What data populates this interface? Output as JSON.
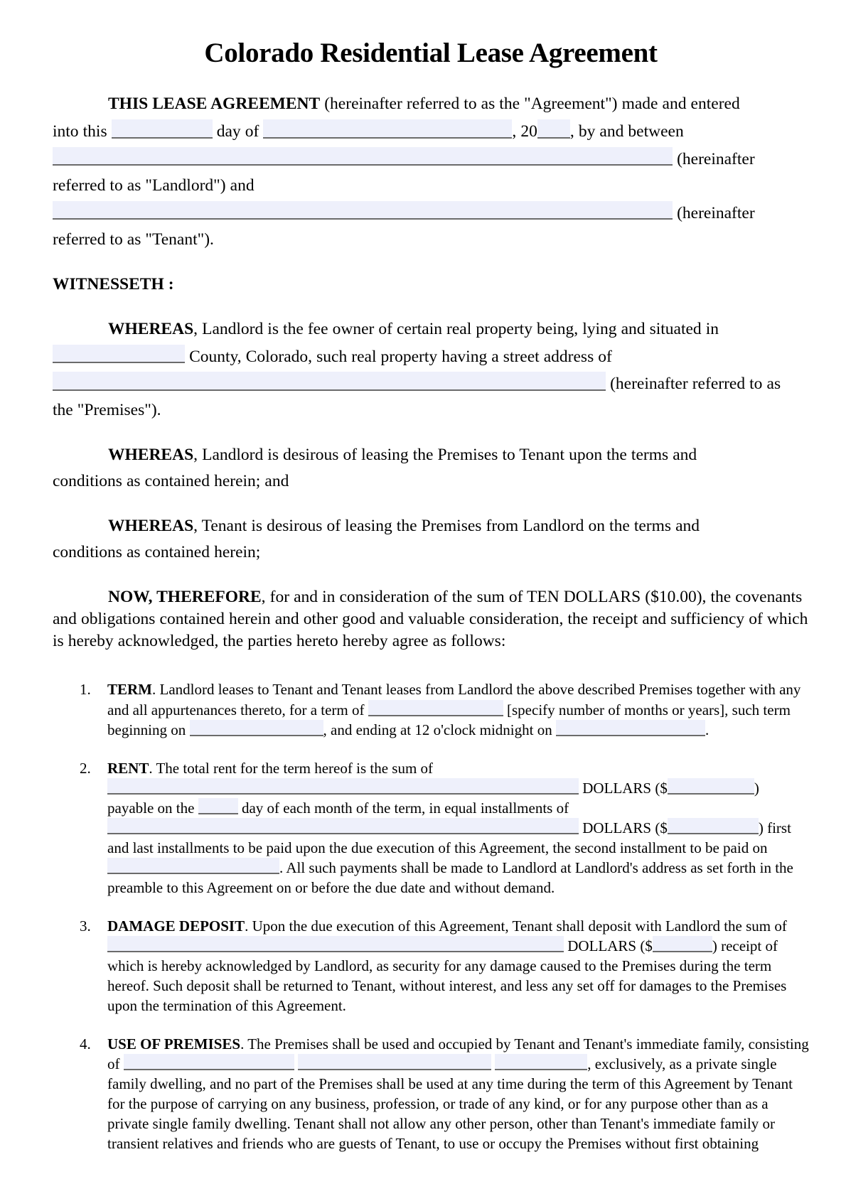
{
  "document": {
    "title": "Colorado Residential Lease Agreement",
    "field_fill_color": "#eef0fb",
    "field_rule_color": "#6b6b6b",
    "page_background": "#ffffff",
    "text_color": "#000000"
  },
  "preamble": {
    "lead_bold": "THIS LEASE AGREEMENT",
    "line1_after_bold": " (hereinafter referred to as the \"Agreement\") made and entered",
    "line2_a": "into this",
    "line2_b": "day of",
    "line2_c": ", 20",
    "line2_d": ", by and between",
    "line3_tail": "(hereinafter",
    "line4": "referred to as \"Landlord\") and",
    "line5_tail": "(hereinafter",
    "line6": "referred to as \"Tenant\")."
  },
  "witnesseth": {
    "heading": "WITNESSETH :"
  },
  "recitals": [
    {
      "bold": "WHEREAS",
      "line1": ", Landlord is the fee owner of certain real property being, lying and situated in",
      "line2": "County, Colorado, such real property having a street address of",
      "line3_tail": "(hereinafter referred to as",
      "line4": "the \"Premises\")."
    },
    {
      "bold": "WHEREAS",
      "line1": ", Landlord is desirous of leasing the Premises to Tenant upon the terms and",
      "line2": "conditions as contained herein; and"
    },
    {
      "bold": "WHEREAS",
      "line1": ", Tenant is desirous of leasing the Premises from Landlord on the terms and",
      "line2": "conditions as contained herein;"
    }
  ],
  "now_therefore": {
    "bold": "NOW, THEREFORE",
    "body": ", for and in consideration of the sum of TEN DOLLARS ($10.00), the covenants and obligations contained herein and other good and valuable consideration, the receipt and sufficiency of which is hereby acknowledged, the parties hereto hereby agree as follows:"
  },
  "sections": [
    {
      "number": "1.",
      "heading": "TERM",
      "t1": ".  Landlord leases to Tenant and Tenant leases from Landlord the above described Premises together with any and all appurtenances thereto, for a term of",
      "t2": "[specify number of months or years], such term beginning on",
      "t3": ", and ending at 12 o'clock midnight on",
      "t4": "."
    },
    {
      "number": "2.",
      "heading": "RENT",
      "t1": ".  The total rent for the term hereof is the sum of",
      "t2": "DOLLARS ($",
      "t3": ") payable on the",
      "t4": "day of each month of the term, in equal installments of",
      "t5": "DOLLARS ($",
      "t6": ") first and last installments to be paid upon the due execution of this Agreement, the second installment to be paid on",
      "t7": ".  All such payments shall be made to Landlord at Landlord's address as set forth in the preamble to this Agreement on or before the due date and without demand."
    },
    {
      "number": "3.",
      "heading": "DAMAGE DEPOSIT",
      "t1": ".  Upon the due execution of this Agreement, Tenant shall deposit with Landlord the sum of",
      "t2": "DOLLARS ($",
      "t3": ") receipt of which is hereby acknowledged by Landlord, as security for any damage caused to the Premises during the term hereof.  Such deposit shall be returned to Tenant, without interest, and less any set off for damages to the Premises upon the termination of this Agreement."
    },
    {
      "number": "4.",
      "heading": "USE OF PREMISES",
      "t1": ".  The Premises shall be used and occupied by Tenant and Tenant's immediate family, consisting of",
      "t2": ", exclusively, as a private single family dwelling, and no part of the Premises shall be used at any time during the term of this Agreement by Tenant for the purpose of carrying on any business, profession, or trade of any kind, or for any purpose other than as a private single family dwelling.  Tenant shall not allow any other person, other than Tenant's immediate family or transient relatives and friends who are guests of Tenant, to use or occupy the Premises without first obtaining"
    }
  ]
}
